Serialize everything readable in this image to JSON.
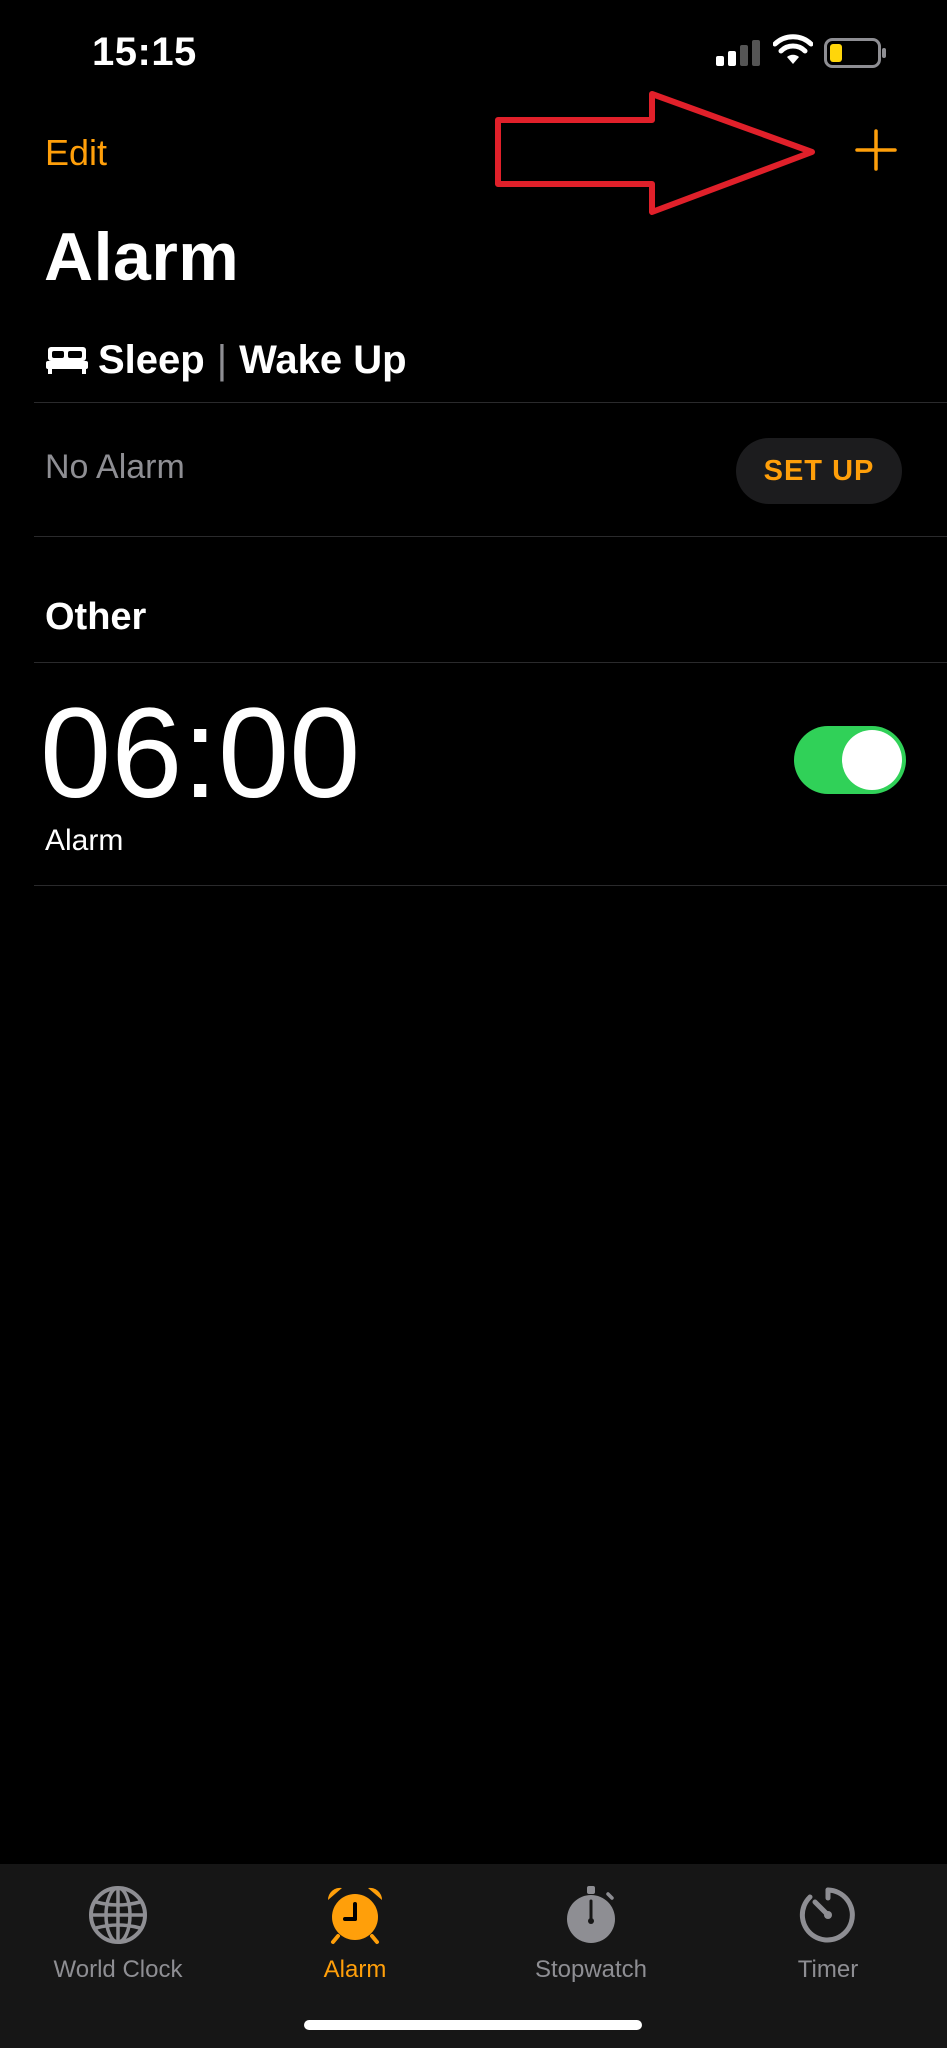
{
  "status_bar": {
    "time": "15:15",
    "icons": [
      "signal-icon",
      "wifi-icon",
      "battery-icon"
    ]
  },
  "nav": {
    "edit_label": "Edit",
    "add_icon": "plus-icon",
    "annotation": "red-arrow-pointing-to-add"
  },
  "page": {
    "title": "Alarm"
  },
  "sleep": {
    "icon": "bed-icon",
    "label_sleep": "Sleep",
    "separator": "|",
    "label_wake": "Wake Up",
    "status": "No Alarm",
    "setup_label": "SET UP"
  },
  "other": {
    "heading": "Other",
    "alarms": [
      {
        "time": "06:00",
        "label": "Alarm",
        "enabled": true
      }
    ]
  },
  "tabs": [
    {
      "label": "World Clock",
      "icon": "globe-icon",
      "active": false
    },
    {
      "label": "Alarm",
      "icon": "alarm-clock-icon",
      "active": true
    },
    {
      "label": "Stopwatch",
      "icon": "stopwatch-icon",
      "active": false
    },
    {
      "label": "Timer",
      "icon": "timer-icon",
      "active": false
    }
  ],
  "colors": {
    "accent": "#ff9f0a",
    "toggle_on": "#30d158",
    "secondary_text": "#8e8e93",
    "background": "#000000",
    "annotation_red": "#e0202a"
  }
}
